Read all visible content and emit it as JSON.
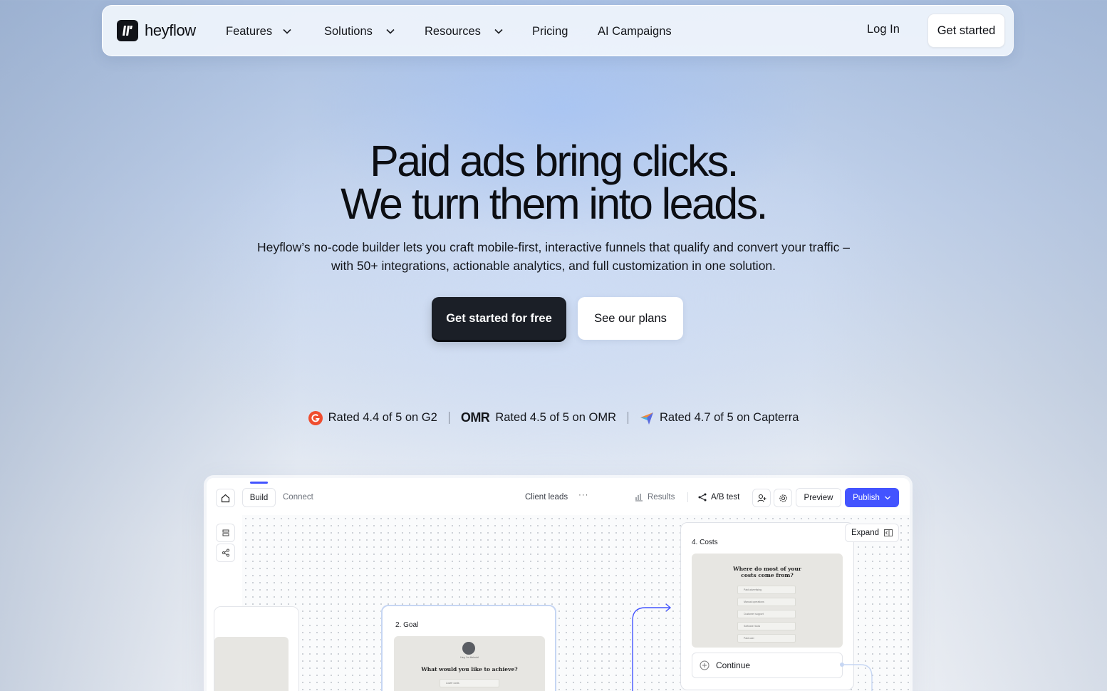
{
  "nav": {
    "logo_text": "heyflow",
    "items": [
      {
        "label": "Features",
        "has_dropdown": true
      },
      {
        "label": "Solutions",
        "has_dropdown": true
      },
      {
        "label": "Resources",
        "has_dropdown": true
      },
      {
        "label": "Pricing",
        "has_dropdown": false
      },
      {
        "label": "AI Campaigns",
        "has_dropdown": false
      }
    ],
    "login_label": "Log In",
    "cta_label": "Get started"
  },
  "hero": {
    "title_line1": "Paid ads bring clicks.",
    "title_line2": "We turn them into leads.",
    "subtitle_line1": "Heyflow’s no-code builder lets you craft mobile-first, interactive funnels that qualify and convert your traffic –",
    "subtitle_line2": "with 50+ integrations, actionable analytics, and full customization in one solution.",
    "primary_cta": "Get started for free",
    "secondary_cta": "See our plans"
  },
  "ratings": [
    {
      "text": "Rated 4.4 of 5 on G2",
      "icon": "g2-icon"
    },
    {
      "text": "Rated 4.5 of 5 on OMR",
      "icon": "omr-icon",
      "logo_text": "OMR"
    },
    {
      "text": "Rated 4.7 of 5 on Capterra",
      "icon": "capterra-icon"
    }
  ],
  "app": {
    "tabs": {
      "build": "Build",
      "connect": "Connect"
    },
    "flow_name": "Client leads",
    "more": "···",
    "results": "Results",
    "abtest": "A/B test",
    "preview": "Preview",
    "publish": "Publish",
    "expand": "Expand",
    "cards": {
      "goal": {
        "title": "2. Goal",
        "question": "What would you like to achieve?",
        "avatar_caption": "Hey, I'm Heinold",
        "option": "Lower costs"
      },
      "costs": {
        "title": "4. Costs",
        "question": "Where do most of your costs come from?",
        "options": [
          "Paid advertising",
          "Manual operations",
          "Customer support",
          "Software /tools",
          "Paid user"
        ],
        "continue": "Continue"
      }
    },
    "colors": {
      "accent": "#4354ff",
      "dark": "#1b1f27"
    }
  }
}
